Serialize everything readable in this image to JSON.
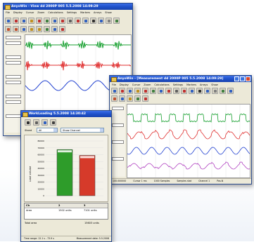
{
  "back_window": {
    "title": "AnyoWin - View dd 2000P 005 5.5.2008 14:09:29",
    "menu": [
      "File",
      "Display",
      "Cursor",
      "Zoom",
      "Calculations",
      "Settings",
      "Markers",
      "Arrays",
      "Show"
    ]
  },
  "mid_window": {
    "title": "AnyoWin - [Measurement dd 2000P 005 5.5.2008 14:09:29]",
    "menu": [
      "File",
      "Display",
      "Cursor",
      "Zoom",
      "Calculations",
      "Settings",
      "Markers",
      "Arrays",
      "Show"
    ],
    "status": [
      "100.000000",
      "Cursor 1 ms",
      "1000 Samples",
      "Samples stat"
    ],
    "status_right": [
      "Channel 1",
      "Pos-N"
    ]
  },
  "front_window": {
    "title": "WorkLoading 5.5.2008 14:30:42",
    "stand_label": "Stand",
    "stand_value": "All",
    "show_label": "Show Channel",
    "chart_data": {
      "type": "bar",
      "ylabel": "Load volume",
      "ylim": [
        0,
        80000
      ],
      "yticks": [
        "80000",
        "70000",
        "60000",
        "50000",
        "40000",
        "30000",
        "20000",
        "10000",
        "0"
      ],
      "values": [
        67500,
        59000
      ],
      "colors": [
        "#2e9c2a",
        "#d63a2a"
      ]
    },
    "table": {
      "headers": [
        "Ch",
        "2",
        "3"
      ],
      "row": {
        "label": "Area",
        "c1": "1502 units",
        "c2": "7101 units"
      }
    },
    "total_label": "Total area",
    "total_value": "15603 units",
    "status_left": "Time range: 12.1 s - 73.9 s",
    "status_right": "Measurement date: 5.5.2008"
  },
  "colors": {
    "green": "#18a030",
    "red": "#e03030",
    "blue": "#2040d0",
    "purple": "#b040c0"
  }
}
